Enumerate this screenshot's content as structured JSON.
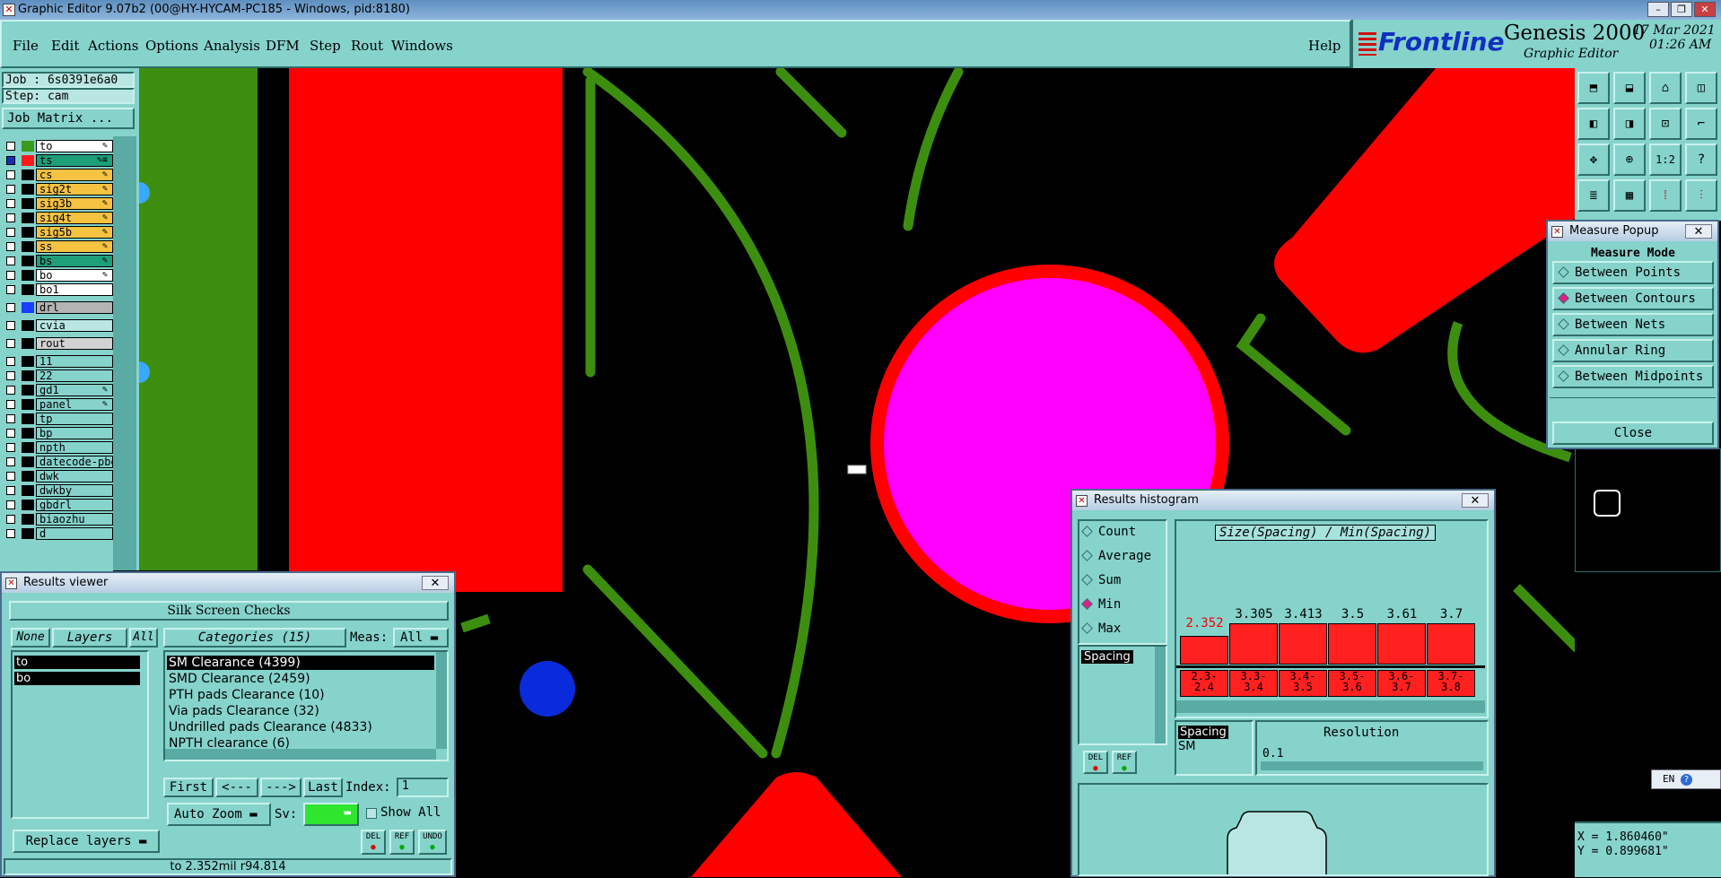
{
  "window": {
    "title": "Graphic Editor 9.07b2 (00@HY-HYCAM-PC185 - Windows, pid:8180)"
  },
  "menu": [
    "File",
    "Edit",
    "Actions",
    "Options",
    "Analysis",
    "DFM",
    "Step",
    "Rout",
    "Windows"
  ],
  "help": "Help",
  "brand": {
    "logo": "Frontline",
    "product": "Genesis 2000",
    "subtitle": "Graphic Editor",
    "date": "17 Mar 2021",
    "time": "01:26 AM"
  },
  "job": {
    "job_line": "Job : 6s0391e6a0",
    "step_line": "Step: cam",
    "matrix_button": "Job Matrix ..."
  },
  "layers": [
    {
      "name": "to",
      "color": "#3a9a1c",
      "bg": "#ffffff",
      "edit": "✎"
    },
    {
      "name": "ts",
      "color": "#ff1a1a",
      "bg": "#1f9e7a",
      "edit": "✎≡",
      "selected": true
    },
    {
      "name": "cs",
      "color": "#000000",
      "bg": "#f5c242",
      "edit": "✎"
    },
    {
      "name": "sig2t",
      "color": "#000000",
      "bg": "#f5c242",
      "edit": "✎"
    },
    {
      "name": "sig3b",
      "color": "#000000",
      "bg": "#f5c242",
      "edit": "✎"
    },
    {
      "name": "sig4t",
      "color": "#000000",
      "bg": "#f5c242",
      "edit": "✎"
    },
    {
      "name": "sig5b",
      "color": "#000000",
      "bg": "#f5c242",
      "edit": "✎"
    },
    {
      "name": "ss",
      "color": "#000000",
      "bg": "#f5c242",
      "edit": "✎"
    },
    {
      "name": "bs",
      "color": "#000000",
      "bg": "#1f9e7a",
      "edit": "✎"
    },
    {
      "name": "bo",
      "color": "#000000",
      "bg": "#ffffff",
      "edit": "✎"
    },
    {
      "name": "bo1",
      "color": "#000000",
      "bg": "#ffffff",
      "edit": ""
    },
    {
      "name": "drl",
      "color": "#1a3cff",
      "bg": "#b4b4b4",
      "edit": ""
    },
    {
      "name": "cvia",
      "color": "#000000",
      "bg": "#b9e6e2",
      "edit": ""
    },
    {
      "name": "rout",
      "color": "#000000",
      "bg": "#d2d2d2",
      "edit": ""
    },
    {
      "name": "11",
      "color": "#000000",
      "bg": "#86d3cc",
      "edit": ""
    },
    {
      "name": "22",
      "color": "#000000",
      "bg": "#86d3cc",
      "edit": ""
    },
    {
      "name": "gd1",
      "color": "#000000",
      "bg": "#86d3cc",
      "edit": "✎"
    },
    {
      "name": "panel",
      "color": "#000000",
      "bg": "#86d3cc",
      "edit": "✎"
    },
    {
      "name": "tp",
      "color": "#000000",
      "bg": "#86d3cc",
      "edit": ""
    },
    {
      "name": "bp",
      "color": "#000000",
      "bg": "#86d3cc",
      "edit": ""
    },
    {
      "name": "npth",
      "color": "#000000",
      "bg": "#86d3cc",
      "edit": ""
    },
    {
      "name": "datecode-pbe",
      "color": "#000000",
      "bg": "#86d3cc",
      "edit": ""
    },
    {
      "name": "dwk",
      "color": "#000000",
      "bg": "#86d3cc",
      "edit": ""
    },
    {
      "name": "dwkby",
      "color": "#000000",
      "bg": "#86d3cc",
      "edit": ""
    },
    {
      "name": "gbdrl",
      "color": "#000000",
      "bg": "#86d3cc",
      "edit": ""
    },
    {
      "name": "biaozhu",
      "color": "#000000",
      "bg": "#86d3cc",
      "edit": ""
    },
    {
      "name": "d",
      "color": "#000000",
      "bg": "#86d3cc",
      "edit": ""
    }
  ],
  "results_viewer": {
    "title": "Results viewer",
    "header": "Silk Screen Checks",
    "none_btn": "None",
    "layers_btn": "Layers",
    "all_btn": "All",
    "layer_list": [
      "to",
      "bo"
    ],
    "categories_label": "Categories (15)",
    "meas_label": "Meas:",
    "meas_value": "All",
    "categories": [
      "SM Clearance (4399)",
      "SMD Clearance (2459)",
      "PTH pads Clearance (10)",
      "Via pads Clearance (32)",
      "Undrilled pads Clearance (4833)",
      "NPTH clearance (6)"
    ],
    "first": "First",
    "prev": "<---",
    "next": "--->",
    "last": "Last",
    "index_label": "Index:",
    "index_value": "1",
    "auto_zoom": "Auto Zoom",
    "sv_label": "Sv:",
    "show_all": "Show All",
    "replace_layers": "Replace layers",
    "del": "DEL",
    "ref": "REF",
    "undo": "UNDO",
    "status": "to 2.352mil  r94.814"
  },
  "measure_popup": {
    "title": "Measure Popup",
    "mode_label": "Measure Mode",
    "modes": [
      "Between Points",
      "Between Contours",
      "Between Nets",
      "Annular Ring",
      "Between Midpoints"
    ],
    "selected_mode": 1,
    "close": "Close"
  },
  "histogram": {
    "title": "Results histogram",
    "options": [
      "Count",
      "Average",
      "Sum",
      "Min",
      "Max"
    ],
    "selected_option": 3,
    "list_item": "Spacing",
    "chart_title": "Size(Spacing) / Min(Spacing)",
    "bars": [
      {
        "value": "2.352",
        "range": "2.3-\n2.4",
        "highlight": true
      },
      {
        "value": "3.305",
        "range": "3.3-\n3.4"
      },
      {
        "value": "3.413",
        "range": "3.4-\n3.5"
      },
      {
        "value": "3.5",
        "range": "3.5-\n3.6"
      },
      {
        "value": "3.61",
        "range": "3.6-\n3.7"
      },
      {
        "value": "3.7",
        "range": "3.7-\n3.8"
      }
    ],
    "sub_list": [
      "Spacing",
      "SM"
    ],
    "resolution_label": "Resolution",
    "resolution_value": "0.1",
    "del": "DEL",
    "ref": "REF"
  },
  "coords": {
    "x": "X = 1.860460\"",
    "y": "Y = 0.899681\""
  },
  "ime": "EN",
  "colors": {
    "panel": "#86d3cc",
    "dark": "#2f6e69",
    "green": "#3a8a10",
    "red": "#ff0000",
    "magenta": "#ff00ff",
    "blue": "#0a2bdb"
  }
}
